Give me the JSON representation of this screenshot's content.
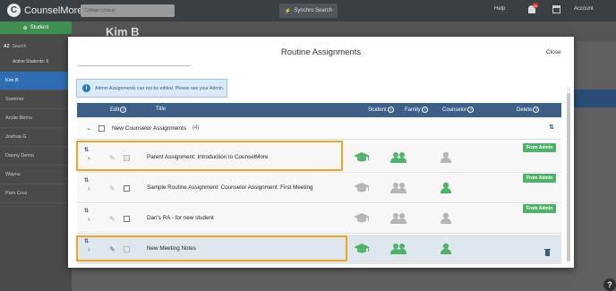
{
  "app": {
    "logo": "CounselMore",
    "college_lookup_placeholder": "College Lookup",
    "synchro_label": "Synchro Search",
    "help_label": "Help",
    "notification_count": "11",
    "account_label": "Account"
  },
  "sidebar": {
    "student_button": "Student",
    "search_placeholder": "Search",
    "active_students_label": "Active Students: 6",
    "items": [
      "Kim B",
      "Summer",
      "Andie Berns",
      "Joshua G",
      "Danny Demo",
      "Wayne",
      "Pam Cruz"
    ]
  },
  "header": {
    "student_name": "Kim B"
  },
  "modal": {
    "title": "Routine Assignments",
    "close_label": "Close",
    "alert_text": "Admin Assignments can not be edited. Please see your Admin.",
    "columns": {
      "edit": "Edit",
      "title": "Title",
      "student": "Student",
      "family": "Family",
      "counselor": "Counselor",
      "delete": "Delete"
    },
    "group": {
      "label": "New Counselor Assignments",
      "count": "(4)"
    },
    "badge_label": "From Admin",
    "rows": [
      {
        "title": "Parent Assignment: Introduction to CounselMore",
        "from_admin": true,
        "student": "active",
        "family": "active",
        "counselor": "inactive"
      },
      {
        "title": "Sample Routine Assignment: Counselor Assignment: First Meeting",
        "from_admin": true,
        "student": "inactive",
        "family": "inactive",
        "counselor": "active"
      },
      {
        "title": "Dan's RA - for new student",
        "from_admin": true,
        "student": "inactive",
        "family": "inactive",
        "counselor": "inactive"
      },
      {
        "title": "New Meeting Notes",
        "from_admin": false,
        "student": "active",
        "family": "active",
        "counselor": "active"
      }
    ]
  },
  "colors": {
    "header_blue": "#3b5f86",
    "active_green": "#4fb26a",
    "inactive_gray": "#b5b5b5",
    "highlight_orange": "#f0a623"
  }
}
